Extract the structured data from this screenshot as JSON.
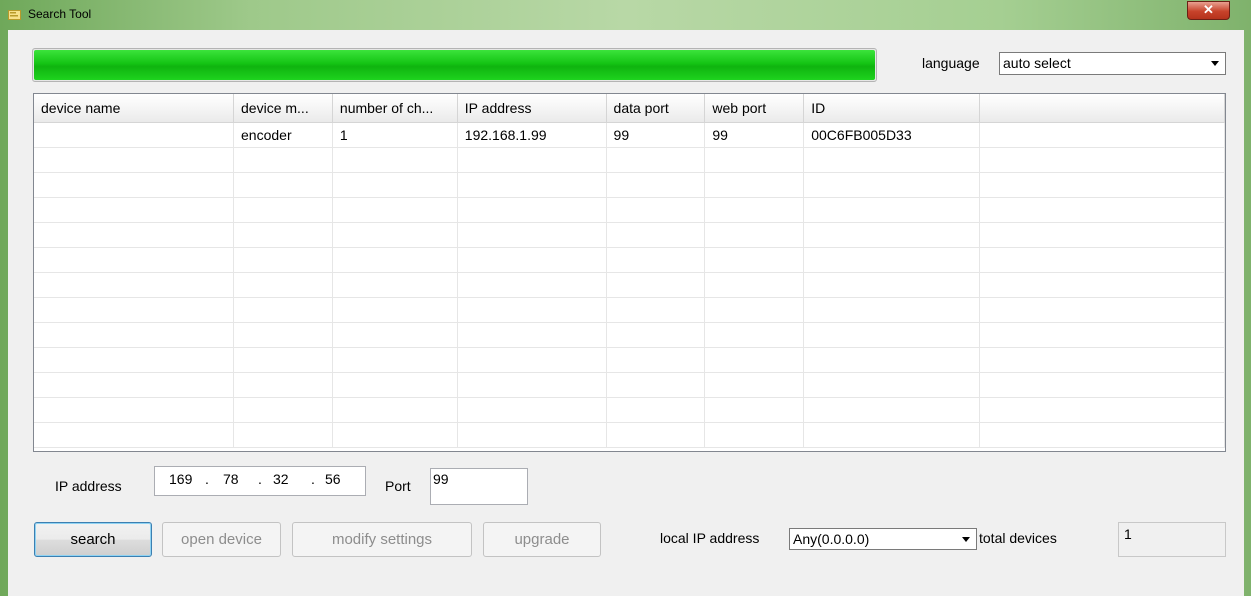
{
  "window": {
    "title": "Search Tool"
  },
  "progress": {
    "percent": 100
  },
  "language": {
    "label": "language",
    "selected": "auto select"
  },
  "table": {
    "columns": [
      "device name",
      "device m...",
      "number of ch...",
      "IP address",
      "data port",
      "web port",
      "ID",
      ""
    ],
    "rows": [
      [
        "",
        "encoder",
        "1",
        "192.168.1.99",
        "99",
        "99",
        "00C6FB005D33",
        ""
      ]
    ]
  },
  "ip": {
    "label": "IP address",
    "octets": [
      "169",
      "78",
      "32",
      "56"
    ]
  },
  "port": {
    "label": "Port",
    "value": "99"
  },
  "buttons": {
    "search": "search",
    "open_device": "open device",
    "modify_settings": "modify settings",
    "upgrade": "upgrade"
  },
  "local_ip": {
    "label": "local IP address",
    "selected": "Any(0.0.0.0)"
  },
  "total": {
    "label": "total devices",
    "value": "1"
  },
  "colors": {
    "progress_green": "#14c414",
    "close_red": "#c7432b"
  }
}
